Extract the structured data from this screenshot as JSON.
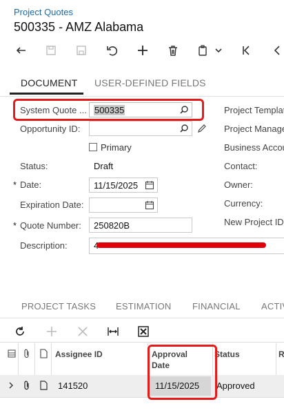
{
  "breadcrumb": "Project Quotes",
  "page_title": "500335 - AMZ Alabama",
  "tabs": [
    "DOCUMENT",
    "USER-DEFINED FIELDS"
  ],
  "form": {
    "system_quote_label": "System Quote ...",
    "system_quote_value": "500335",
    "opportunity_label": "Opportunity ID:",
    "opportunity_value": "",
    "primary_label": "Primary",
    "status_label": "Status:",
    "status_value": "Draft",
    "date_label": "Date:",
    "date_value": "11/15/2025",
    "expiration_label": "Expiration Date:",
    "expiration_value": "",
    "quote_number_label": "Quote Number:",
    "quote_number_value": "250820B",
    "description_label": "Description:",
    "description_value": "4",
    "required_mark": "*"
  },
  "right_labels": [
    "Project Templat",
    "Project Manage",
    "Business Accou",
    "Contact:",
    "Owner:",
    "Currency:",
    "New Project ID"
  ],
  "bottom_tabs": [
    "PROJECT TASKS",
    "ESTIMATION",
    "FINANCIAL",
    "ACTIV"
  ],
  "grid": {
    "headers": {
      "assignee": "Assignee ID",
      "approval_line1": "Approval",
      "approval_line2": "Date",
      "status": "Status",
      "extra": "R"
    },
    "rows": [
      {
        "assignee": "141520",
        "approval_date": "11/15/2025",
        "status": "Approved"
      }
    ]
  },
  "colors": {
    "link": "#1a6aa8",
    "highlight": "#e31b1b",
    "redaction": "#e0000a"
  }
}
